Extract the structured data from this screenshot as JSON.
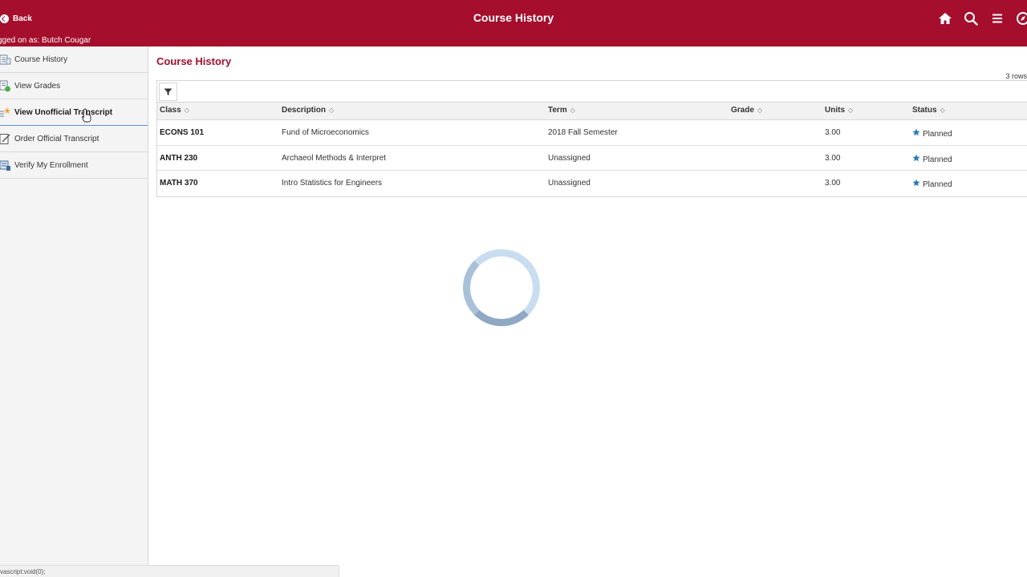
{
  "header": {
    "back_label": "Back",
    "title": "Course History",
    "logged_on": "gged on as: Butch Cougar",
    "icons": [
      "home-icon",
      "search-icon",
      "menu-icon",
      "compass-icon"
    ]
  },
  "sidebar": {
    "items": [
      {
        "label": "Course History",
        "icon": "list-icon"
      },
      {
        "label": "View Grades",
        "icon": "grades-icon"
      },
      {
        "label": "View Unofficial Transcript",
        "icon": "transcript-icon",
        "active": true
      },
      {
        "label": "Order Official Transcript",
        "icon": "edit-doc-icon"
      },
      {
        "label": "Verify My Enrollment",
        "icon": "enrollment-icon"
      }
    ]
  },
  "main": {
    "title": "Course History",
    "row_count": "3 rows",
    "columns": [
      "Class",
      "Description",
      "Term",
      "Grade",
      "Units",
      "Status"
    ],
    "rows": [
      {
        "class": "ECONS 101",
        "description": "Fund of Microeconomics",
        "term": "2018 Fall Semester",
        "grade": "",
        "units": "3.00",
        "status": "Planned"
      },
      {
        "class": "ANTH 230",
        "description": "Archaeol Methods & Interpret",
        "term": "Unassigned",
        "grade": "",
        "units": "3.00",
        "status": "Planned"
      },
      {
        "class": "MATH 370",
        "description": "Intro Statistics for Engineers",
        "term": "Unassigned",
        "grade": "",
        "units": "3.00",
        "status": "Planned"
      }
    ]
  },
  "statusbar": {
    "text": "vascript:void(0);"
  },
  "colors": {
    "brand": "#a50e2d",
    "star": "#2b7bb9"
  }
}
